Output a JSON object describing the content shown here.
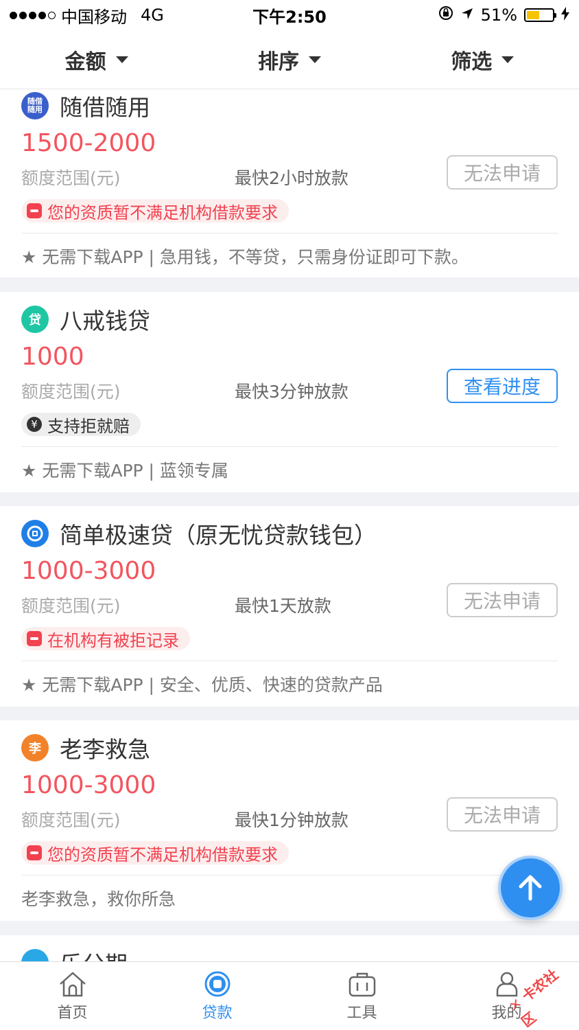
{
  "status_bar": {
    "carrier": "中国移动",
    "network": "4G",
    "time": "下午2:50",
    "battery": "51%",
    "battery_level": 0.51
  },
  "filters": [
    {
      "label": "金额"
    },
    {
      "label": "排序"
    },
    {
      "label": "筛选"
    }
  ],
  "products": [
    {
      "name": "随借随用",
      "logo_text": "随借随用",
      "logo_color": "#3a5fcc",
      "amount": "1500-2000",
      "range_label": "额度范围(元)",
      "speed": "最快2小时放款",
      "button": "无法申请",
      "button_state": "disabled",
      "tag": "您的资质暂不满足机构借款要求",
      "tag_type": "warn",
      "desc": "★ 无需下载APP | 急用钱，不等贷，只需身份证即可下款。"
    },
    {
      "name": "八戒钱贷",
      "logo_text": "贷",
      "logo_color": "#1fc6a4",
      "amount": "1000",
      "range_label": "额度范围(元)",
      "speed": "最快3分钟放款",
      "button": "查看进度",
      "button_state": "active",
      "tag": "支持拒就赔",
      "tag_type": "ok",
      "desc": "★ 无需下载APP | 蓝领专属"
    },
    {
      "name": "简单极速贷（原无忧贷款钱包）",
      "logo_text": "",
      "logo_color": "#1f7fe6",
      "amount": "1000-3000",
      "range_label": "额度范围(元)",
      "speed": "最快1天放款",
      "button": "无法申请",
      "button_state": "disabled",
      "tag": "在机构有被拒记录",
      "tag_type": "warn",
      "desc": "★ 无需下载APP | 安全、优质、快速的贷款产品"
    },
    {
      "name": "老李救急",
      "logo_text": "李",
      "logo_color": "#f2822a",
      "amount": "1000-3000",
      "range_label": "额度范围(元)",
      "speed": "最快1分钟放款",
      "button": "无法申请",
      "button_state": "disabled",
      "tag": "您的资质暂不满足机构借款要求",
      "tag_type": "warn",
      "desc": "老李救急，救你所急"
    },
    {
      "name": "乐分期",
      "logo_color": "#2aa8e6"
    }
  ],
  "tabs": [
    {
      "label": "首页",
      "icon": "home-icon"
    },
    {
      "label": "贷款",
      "icon": "loan-icon",
      "active": true
    },
    {
      "label": "工具",
      "icon": "toolbox-icon"
    },
    {
      "label": "我的",
      "icon": "profile-icon"
    }
  ],
  "watermark": "卡农社区",
  "colors": {
    "accent": "#2f8ff0",
    "amount": "#f2555f",
    "warn": "#f2414f"
  }
}
